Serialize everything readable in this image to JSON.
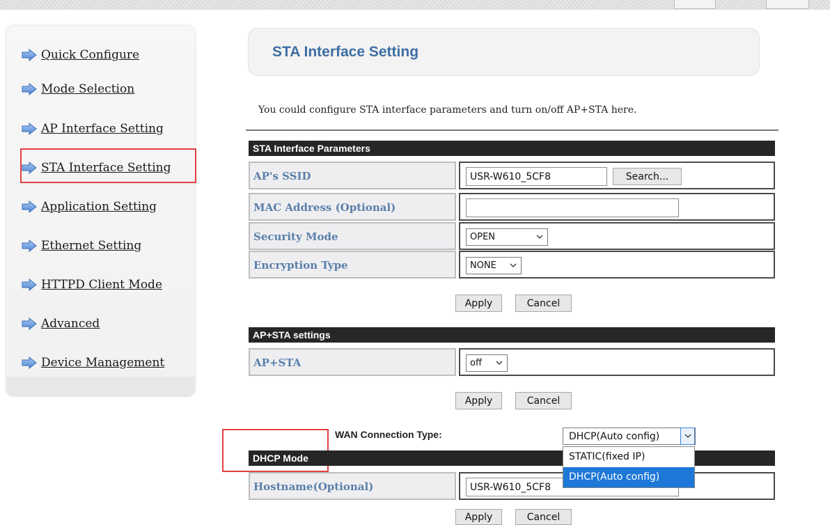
{
  "sidebar": {
    "items": [
      {
        "label": "Quick Configure"
      },
      {
        "label": "Mode Selection"
      },
      {
        "label": "AP Interface Setting"
      },
      {
        "label": "STA Interface Setting"
      },
      {
        "label": "Application Setting"
      },
      {
        "label": "Ethernet Setting"
      },
      {
        "label": "HTTPD Client Mode"
      },
      {
        "label": "Advanced"
      },
      {
        "label": "Device Management"
      }
    ],
    "selected": "STA Interface Setting"
  },
  "page": {
    "title": "STA Interface Setting",
    "intro": "You could configure STA interface parameters and turn on/off AP+STA here."
  },
  "sta_params": {
    "heading": "STA Interface Parameters",
    "ssid_label": "AP's SSID",
    "ssid_value": "USR-W610_5CF8",
    "search_button": "Search...",
    "mac_label": "MAC Address (Optional)",
    "mac_value": "",
    "security_label": "Security Mode",
    "security_value": "OPEN",
    "encryption_label": "Encryption Type",
    "encryption_value": "NONE",
    "apply": "Apply",
    "cancel": "Cancel"
  },
  "apsta": {
    "heading": "AP+STA settings",
    "label": "AP+STA",
    "value": "off",
    "apply": "Apply",
    "cancel": "Cancel"
  },
  "wan": {
    "label": "WAN Connection Type:",
    "value": "DHCP(Auto config)",
    "options": [
      "STATIC(fixed IP)",
      "DHCP(Auto config)"
    ]
  },
  "dhcp": {
    "heading": "DHCP Mode",
    "hostname_label": "Hostname(Optional)",
    "hostname_value": "USR-W610_5CF8",
    "apply": "Apply",
    "cancel": "Cancel"
  },
  "colors": {
    "highlight_border": "#e34040",
    "label_text": "#5a7fa9",
    "section_header": "#262626",
    "title_text": "#3d6ea3",
    "dropdown_selected": "#1e78d8"
  }
}
